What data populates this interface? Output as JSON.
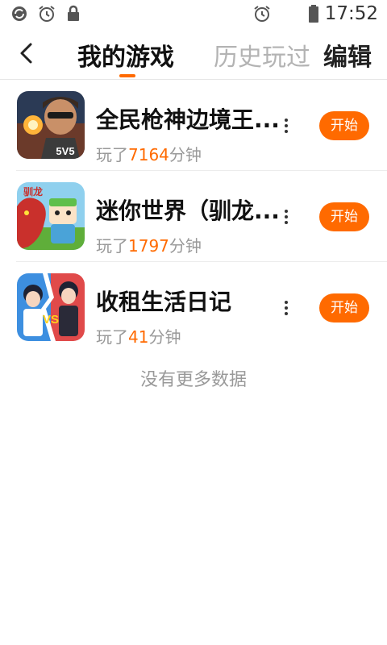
{
  "status_bar": {
    "time": "17:52",
    "icons": [
      "sync-icon",
      "alarm-icon",
      "lock-icon",
      "alarm-icon",
      "battery-icon"
    ]
  },
  "header": {
    "tab_mine": "我的游戏",
    "tab_history": "历史玩过",
    "edit": "编辑"
  },
  "games": [
    {
      "name": "全民枪神边境王...",
      "played_prefix": "玩了",
      "played_minutes": "7164",
      "played_suffix": "分钟",
      "start_label": "开始"
    },
    {
      "name": "迷你世界（驯龙...",
      "played_prefix": "玩了",
      "played_minutes": "1797",
      "played_suffix": "分钟",
      "start_label": "开始"
    },
    {
      "name": "收租生活日记",
      "played_prefix": "玩了",
      "played_minutes": "41",
      "played_suffix": "分钟",
      "start_label": "开始"
    }
  ],
  "icon_text": {
    "game1": "5V5",
    "game2": "驯龙",
    "game3": "VS"
  },
  "footer": {
    "no_more": "没有更多数据"
  },
  "colors": {
    "accent": "#ff6a00",
    "text_primary": "#111111",
    "text_secondary": "#999999"
  }
}
